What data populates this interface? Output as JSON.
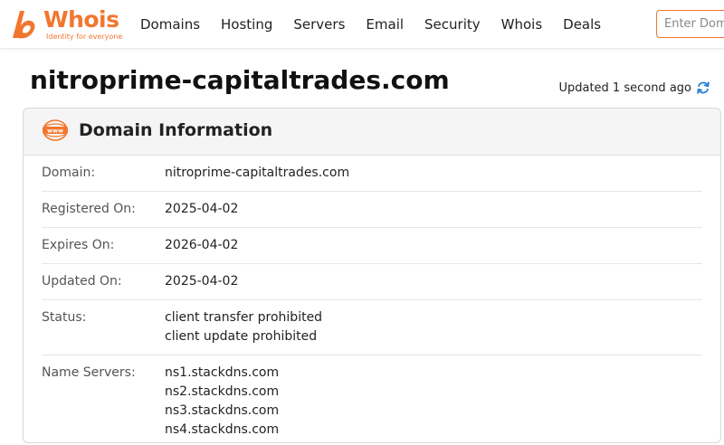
{
  "header": {
    "logo": {
      "word": "Whois",
      "tagline": "Identity for everyone"
    },
    "nav": [
      "Domains",
      "Hosting",
      "Servers",
      "Email",
      "Security",
      "Whois",
      "Deals"
    ],
    "search": {
      "placeholder": "Enter Domain or IP",
      "value": ""
    }
  },
  "page": {
    "domain_title": "nitroprime-capitaltrades.com",
    "updated_text": "Updated 1 second ago"
  },
  "card": {
    "title": "Domain Information",
    "icon": "www-icon",
    "rows": [
      {
        "label": "Domain:",
        "values": [
          "nitroprime-capitaltrades.com"
        ]
      },
      {
        "label": "Registered On:",
        "values": [
          "2025-04-02"
        ]
      },
      {
        "label": "Expires On:",
        "values": [
          "2026-04-02"
        ]
      },
      {
        "label": "Updated On:",
        "values": [
          "2025-04-02"
        ]
      },
      {
        "label": "Status:",
        "values": [
          "client transfer prohibited",
          "client update prohibited"
        ]
      },
      {
        "label": "Name Servers:",
        "values": [
          "ns1.stackdns.com",
          "ns2.stackdns.com",
          "ns3.stackdns.com",
          "ns4.stackdns.com"
        ]
      }
    ]
  },
  "colors": {
    "brand": "#f2762e",
    "refresh": "#2b7fd6"
  }
}
